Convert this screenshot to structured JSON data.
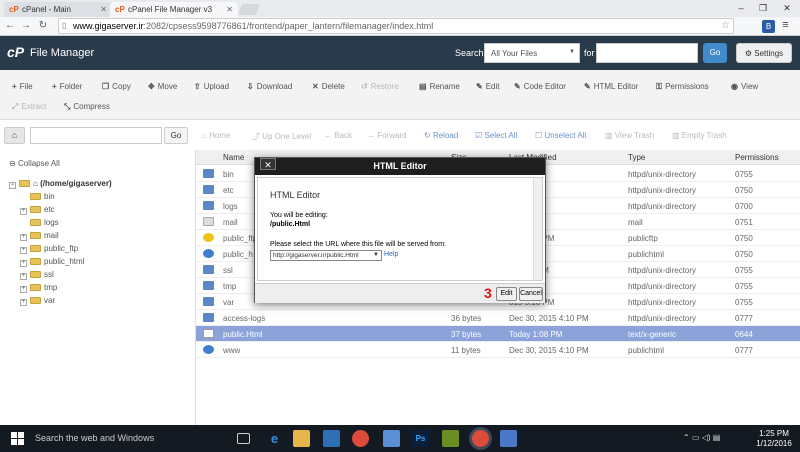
{
  "browser": {
    "tabs": [
      {
        "title": "cPanel - Main",
        "active": false
      },
      {
        "title": "cPanel File Manager v3",
        "active": true
      }
    ],
    "url_host": "www.gigaserver.ir",
    "url_rest": ":2082/cpsess9598776861/frontend/paper_lantern/filemanager/index.html",
    "window_controls": [
      "–",
      "❐",
      "✕"
    ]
  },
  "app": {
    "title": "File Manager",
    "search_label": "Search",
    "search_scope": "All Your Files",
    "for_label": "for",
    "go_label": "Go",
    "settings_label": "Settings"
  },
  "toolbar": {
    "row1": [
      "File",
      "Folder",
      "Copy",
      "Move",
      "Upload",
      "Download",
      "Delete",
      "Restore",
      "Rename",
      "Edit",
      "Code Editor",
      "HTML Editor",
      "Permissions",
      "View"
    ],
    "row2": [
      "Extract",
      "Compress"
    ]
  },
  "nav": {
    "go_label": "Go",
    "buttons": [
      "Home",
      "Up One Level",
      "Back",
      "Forward",
      "Reload",
      "Select All",
      "Unselect All",
      "View Trash",
      "Empty Trash"
    ]
  },
  "tree": {
    "collapse_label": "Collapse All",
    "root": "(/home/gigaserver)",
    "items": [
      "bin",
      "etc",
      "logs",
      "mail",
      "public_ftp",
      "public_html",
      "ssl",
      "tmp",
      "var"
    ]
  },
  "grid": {
    "columns": [
      "Name",
      "Size",
      "Last Modified",
      "Type",
      "Permissions"
    ],
    "rows": [
      {
        "name": "bin",
        "size": "",
        "modified": "6 3:00 PM",
        "type": "httpd/unix-directory",
        "perms": "0755"
      },
      {
        "name": "etc",
        "size": "",
        "modified": "6 3:57 PM",
        "type": "httpd/unix-directory",
        "perms": "0750"
      },
      {
        "name": "logs",
        "size": "",
        "modified": "6 3:41 PM",
        "type": "httpd/unix-directory",
        "perms": "0700"
      },
      {
        "name": "mail",
        "size": "",
        "modified": "22 PM",
        "type": "mail",
        "perms": "0751"
      },
      {
        "name": "public_ftp",
        "size": "",
        "modified": "015 4:10 PM",
        "type": "publicftp",
        "perms": "0750"
      },
      {
        "name": "public_h",
        "size": "",
        "modified": "2:02 PM",
        "type": "publichtml",
        "perms": "0750"
      },
      {
        "name": "ssl",
        "size": "",
        "modified": "6 11:24 AM",
        "type": "httpd/unix-directory",
        "perms": "0755"
      },
      {
        "name": "tmp",
        "size": "",
        "modified": "6 3:41 PM",
        "type": "httpd/unix-directory",
        "perms": "0755"
      },
      {
        "name": "var",
        "size": "",
        "modified": "015 5:10 PM",
        "type": "httpd/unix-directory",
        "perms": "0755"
      },
      {
        "name": "access-logs",
        "size": "36 bytes",
        "modified": "Dec 30, 2015 4:10 PM",
        "type": "httpd/unix-directory",
        "perms": "0777"
      },
      {
        "name": "public.Html",
        "size": "37 bytes",
        "modified": "Today 1:08 PM",
        "type": "text/x-generic",
        "perms": "0644"
      },
      {
        "name": "www",
        "size": "11 bytes",
        "modified": "Dec 30, 2015 4:10 PM",
        "type": "publichtml",
        "perms": "0777"
      }
    ],
    "selected_row": 10
  },
  "dialog": {
    "title": "HTML Editor",
    "close_label": "✕",
    "heading": "HTML Editor",
    "editing_label": "You will be editing:",
    "file_path": "/public.Html",
    "url_prompt": "Please select the URL where this file will be served from:",
    "url_value": "http://gigaserver.ir/public.Html",
    "help_label": "Help",
    "step_number": "3",
    "edit_label": "Edit",
    "cancel_label": "Cancel"
  },
  "taskbar": {
    "search_placeholder": "Search the web and Windows",
    "time": "1:25 PM",
    "date": "1/12/2016"
  }
}
